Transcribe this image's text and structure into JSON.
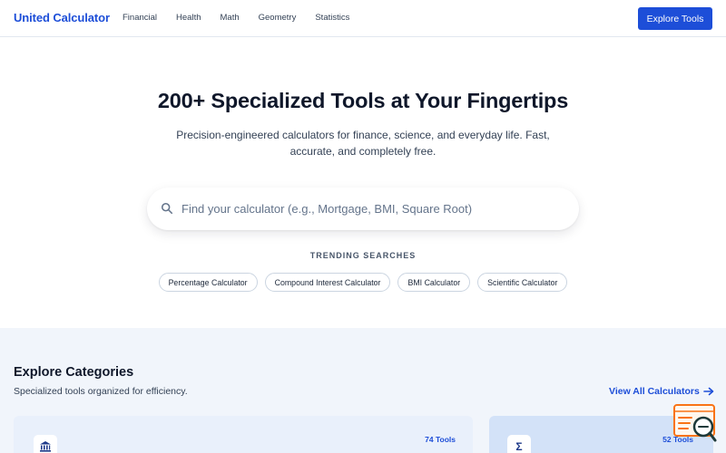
{
  "header": {
    "brand": "United Calculator",
    "nav": [
      "Financial",
      "Health",
      "Math",
      "Geometry",
      "Statistics"
    ],
    "cta_label": "Explore Tools"
  },
  "hero": {
    "title": "200+ Specialized Tools at Your Fingertips",
    "subtitle": "Precision-engineered calculators for finance, science, and everyday life. Fast, accurate, and completely free.",
    "search_placeholder": "Find your calculator (e.g., Mortgage, BMI, Square Root)",
    "search_icon": "search-icon",
    "trending_label": "TRENDING SEARCHES",
    "trending": [
      "Percentage Calculator",
      "Compound Interest Calculator",
      "BMI Calculator",
      "Scientific Calculator"
    ]
  },
  "categories": {
    "title": "Explore Categories",
    "subtitle": "Specialized tools organized for efficiency.",
    "view_all_label": "View All Calculators",
    "cards": [
      {
        "icon": "bank-icon",
        "count": "74 Tools"
      },
      {
        "icon": "sigma-icon",
        "glyph": "Σ",
        "count": "52 Tools"
      }
    ]
  },
  "colors": {
    "primary": "#1d4ed8",
    "text": "#0f172a",
    "section_bg": "#f1f5fb",
    "widget_accent": "#f97316",
    "widget_dark": "#1e3a3a"
  }
}
